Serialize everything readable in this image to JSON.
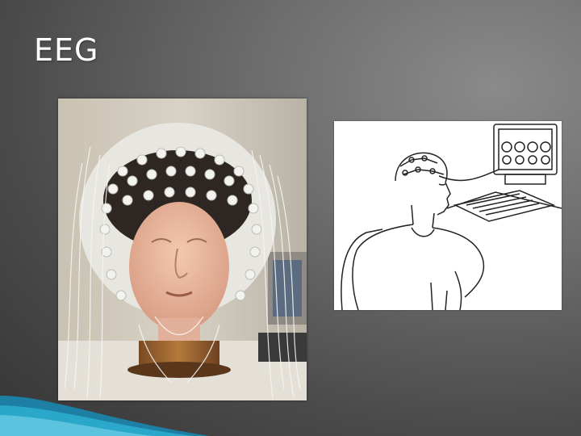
{
  "slide": {
    "title": "EEG"
  },
  "images": [
    {
      "name": "mannequin-eeg-cap-photo"
    },
    {
      "name": "eeg-patient-line-drawing"
    }
  ],
  "colors": {
    "accent_blue": "#2aa7c9",
    "title_text": "#ffffff"
  }
}
